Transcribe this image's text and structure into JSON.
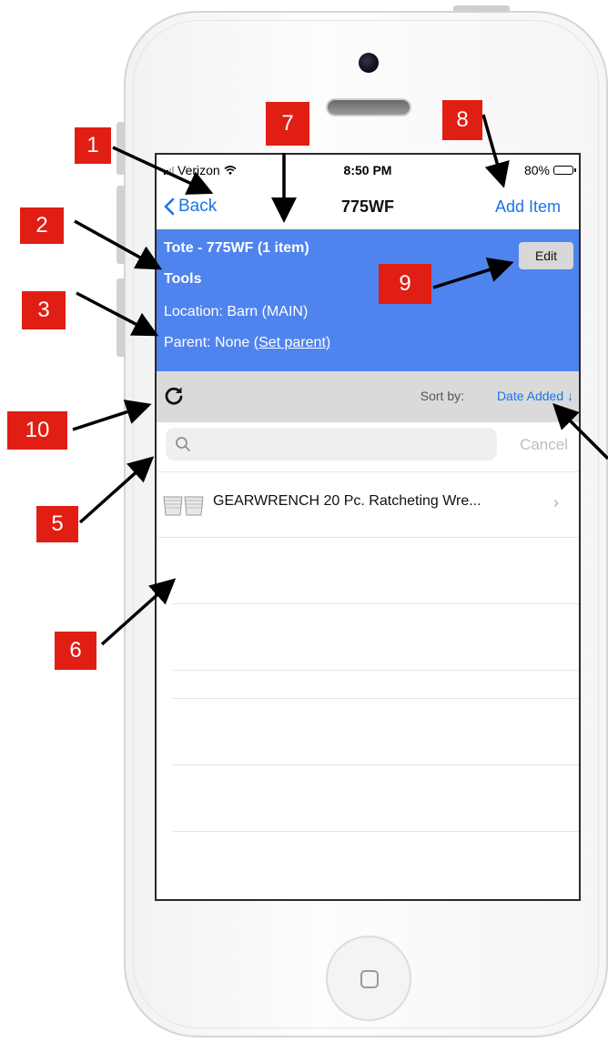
{
  "status_bar": {
    "carrier": "Verizon",
    "time": "8:50 PM",
    "battery_text": "80%",
    "battery_level": 0.8
  },
  "nav": {
    "back_label": "Back",
    "title": "775WF",
    "add_label": "Add Item"
  },
  "container": {
    "line1_name": "Tote - 775WF",
    "line1_count": " (1 item)",
    "category": "Tools",
    "location": "Location: Barn (MAIN)",
    "parent_prefix": "Parent: None ",
    "set_parent_link": "(Set parent)",
    "edit_label": "Edit"
  },
  "sort": {
    "label": "Sort by:",
    "value": "Date Added ↓"
  },
  "search": {
    "placeholder": "",
    "value": "",
    "cancel_label": "Cancel"
  },
  "items": [
    {
      "label": "GEARWRENCH 20 Pc. Ratcheting Wre..."
    }
  ],
  "callouts": [
    "1",
    "2",
    "3",
    "5",
    "6",
    "7",
    "8",
    "9",
    "10"
  ],
  "colors": {
    "accent": "#1a73e8",
    "header_bg": "#4f83ee",
    "callout": "#e11e13"
  }
}
